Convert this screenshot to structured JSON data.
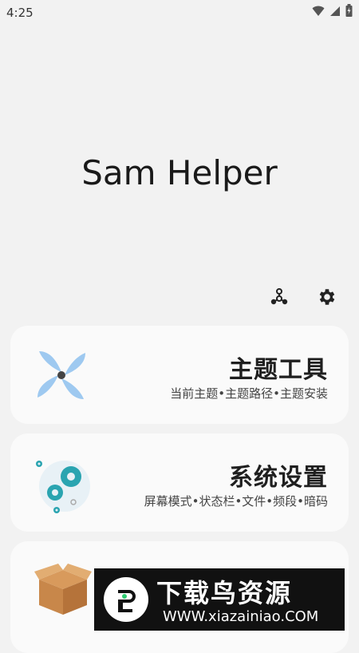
{
  "status_bar": {
    "time": "4:25"
  },
  "app": {
    "title": "Sam Helper"
  },
  "cards": [
    {
      "title": "主题工具",
      "subtitle": "当前主题•主题路径•主题安装",
      "icon": "fan-icon"
    },
    {
      "title": "系统设置",
      "subtitle": "屏幕模式•状态栏•文件•频段•暗码",
      "icon": "gears-icon"
    },
    {
      "title": "",
      "subtitle": "",
      "icon": "box-icon"
    }
  ],
  "watermark": {
    "title": "下载鸟资源",
    "url": "WWW.xiazainiao.COM"
  },
  "colors": {
    "background": "#f2f2f2",
    "card": "#fafafa",
    "fan_blue": "#9ec9f0",
    "gear_teal": "#2aa4b0",
    "box_brown": "#c8874a"
  }
}
